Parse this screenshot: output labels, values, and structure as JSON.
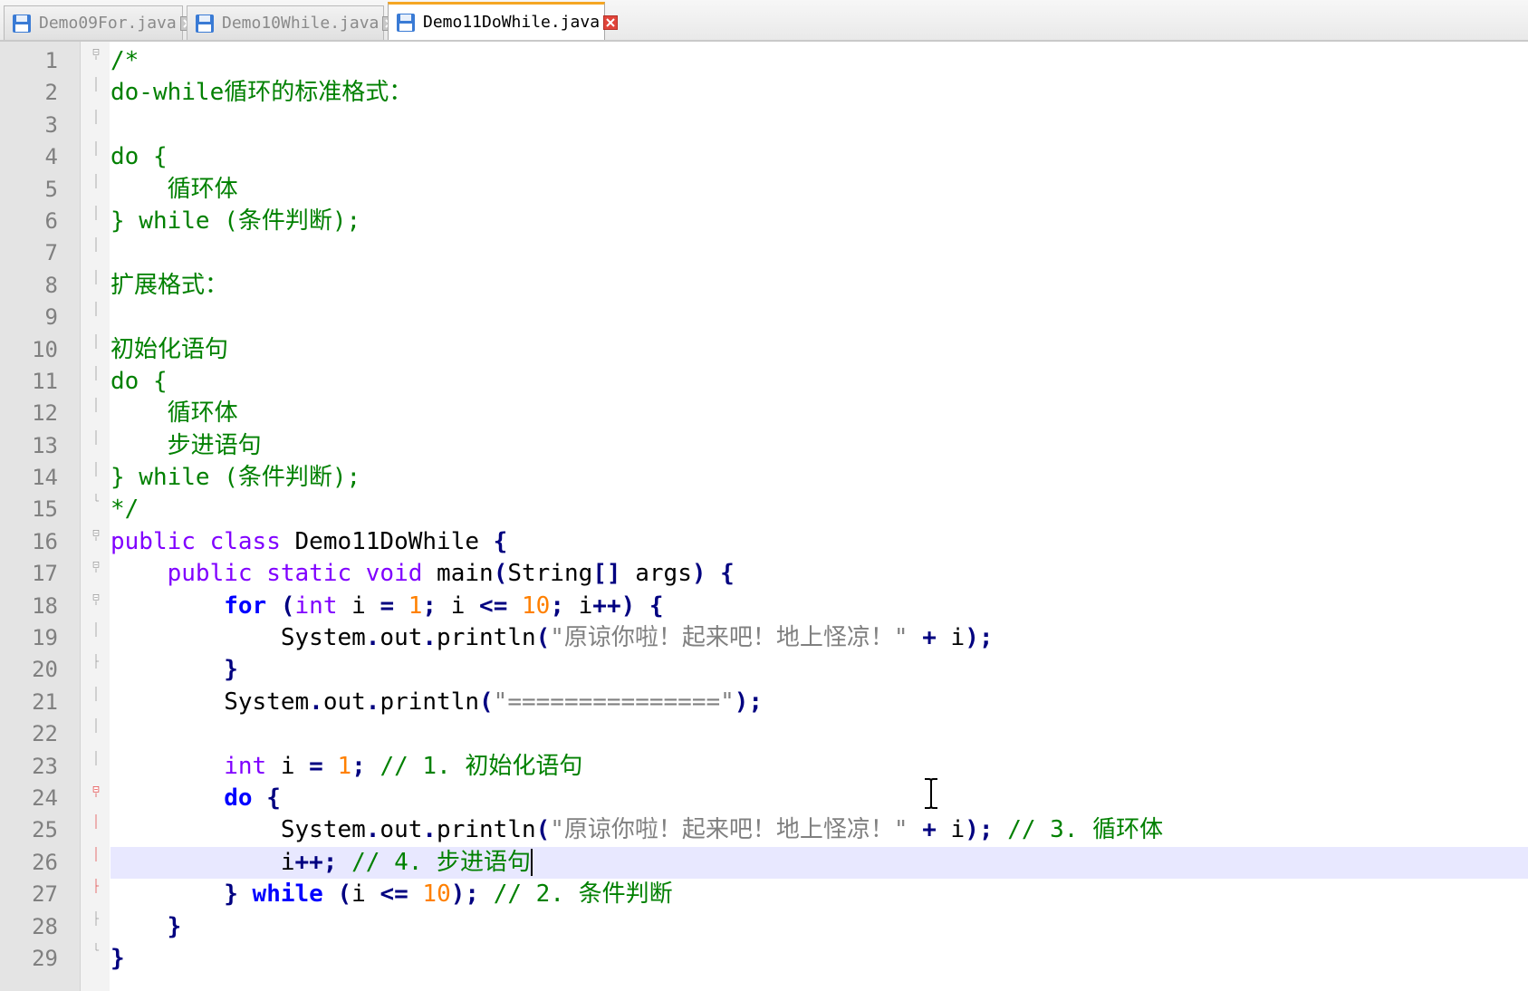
{
  "tabs": [
    {
      "label": "Demo09For.java",
      "active": false
    },
    {
      "label": "Demo10While.java",
      "active": false
    },
    {
      "label": "Demo11DoWhile.java",
      "active": true
    }
  ],
  "colors": {
    "comment": "#008000",
    "keyword": "#8000ff",
    "keyword_bold": "#0000ff",
    "number": "#ff8000",
    "string": "#808080",
    "operator": "#000080",
    "current_line": "#e8e8ff",
    "active_tab_accent": "#f5a623"
  },
  "editor": {
    "current_line": 26,
    "lines": [
      {
        "num": "1",
        "fold": "box-open",
        "tokens": [
          {
            "t": "/*",
            "c": "comment"
          }
        ]
      },
      {
        "num": "2",
        "fold": "line",
        "tokens": [
          {
            "t": "do-while循环的标准格式：",
            "c": "comment"
          }
        ]
      },
      {
        "num": "3",
        "fold": "line",
        "tokens": []
      },
      {
        "num": "4",
        "fold": "line",
        "tokens": [
          {
            "t": "do {",
            "c": "comment"
          }
        ]
      },
      {
        "num": "5",
        "fold": "line",
        "tokens": [
          {
            "t": "    循环体",
            "c": "comment"
          }
        ]
      },
      {
        "num": "6",
        "fold": "line",
        "tokens": [
          {
            "t": "} while (条件判断);",
            "c": "comment"
          }
        ]
      },
      {
        "num": "7",
        "fold": "line",
        "tokens": []
      },
      {
        "num": "8",
        "fold": "line",
        "tokens": [
          {
            "t": "扩展格式：",
            "c": "comment"
          }
        ]
      },
      {
        "num": "9",
        "fold": "line",
        "tokens": []
      },
      {
        "num": "10",
        "fold": "line",
        "tokens": [
          {
            "t": "初始化语句",
            "c": "comment"
          }
        ]
      },
      {
        "num": "11",
        "fold": "line",
        "tokens": [
          {
            "t": "do {",
            "c": "comment"
          }
        ]
      },
      {
        "num": "12",
        "fold": "line",
        "tokens": [
          {
            "t": "    循环体",
            "c": "comment"
          }
        ]
      },
      {
        "num": "13",
        "fold": "line",
        "tokens": [
          {
            "t": "    步进语句",
            "c": "comment"
          }
        ]
      },
      {
        "num": "14",
        "fold": "line",
        "tokens": [
          {
            "t": "} while (条件判断);",
            "c": "comment"
          }
        ]
      },
      {
        "num": "15",
        "fold": "end",
        "tokens": [
          {
            "t": "*/",
            "c": "comment"
          }
        ]
      },
      {
        "num": "16",
        "fold": "box-open",
        "tokens": [
          {
            "t": "public",
            "c": "kw"
          },
          {
            "t": " ",
            "c": "plain"
          },
          {
            "t": "class",
            "c": "kw"
          },
          {
            "t": " Demo11DoWhile ",
            "c": "plain"
          },
          {
            "t": "{",
            "c": "op"
          }
        ]
      },
      {
        "num": "17",
        "fold": "box-open",
        "tokens": [
          {
            "t": "    ",
            "c": "plain"
          },
          {
            "t": "public",
            "c": "kw"
          },
          {
            "t": " ",
            "c": "plain"
          },
          {
            "t": "static",
            "c": "kw"
          },
          {
            "t": " ",
            "c": "plain"
          },
          {
            "t": "void",
            "c": "kw"
          },
          {
            "t": " main",
            "c": "plain"
          },
          {
            "t": "(",
            "c": "op"
          },
          {
            "t": "String",
            "c": "plain"
          },
          {
            "t": "[]",
            "c": "op"
          },
          {
            "t": " args",
            "c": "plain"
          },
          {
            "t": ")",
            "c": "op"
          },
          {
            "t": " ",
            "c": "plain"
          },
          {
            "t": "{",
            "c": "op"
          }
        ]
      },
      {
        "num": "18",
        "fold": "box-open",
        "tokens": [
          {
            "t": "        ",
            "c": "plain"
          },
          {
            "t": "for",
            "c": "kwb"
          },
          {
            "t": " ",
            "c": "plain"
          },
          {
            "t": "(",
            "c": "op"
          },
          {
            "t": "int",
            "c": "kw"
          },
          {
            "t": " i ",
            "c": "plain"
          },
          {
            "t": "=",
            "c": "op"
          },
          {
            "t": " ",
            "c": "plain"
          },
          {
            "t": "1",
            "c": "num"
          },
          {
            "t": ";",
            "c": "op"
          },
          {
            "t": " i ",
            "c": "plain"
          },
          {
            "t": "<=",
            "c": "op"
          },
          {
            "t": " ",
            "c": "plain"
          },
          {
            "t": "10",
            "c": "num"
          },
          {
            "t": ";",
            "c": "op"
          },
          {
            "t": " i",
            "c": "plain"
          },
          {
            "t": "++)",
            "c": "op"
          },
          {
            "t": " ",
            "c": "plain"
          },
          {
            "t": "{",
            "c": "op"
          }
        ]
      },
      {
        "num": "19",
        "fold": "line",
        "tokens": [
          {
            "t": "            System",
            "c": "plain"
          },
          {
            "t": ".",
            "c": "op"
          },
          {
            "t": "out",
            "c": "plain"
          },
          {
            "t": ".",
            "c": "op"
          },
          {
            "t": "println",
            "c": "plain"
          },
          {
            "t": "(",
            "c": "op"
          },
          {
            "t": "\"原谅你啦！起来吧！地上怪凉！\"",
            "c": "str"
          },
          {
            "t": " ",
            "c": "plain"
          },
          {
            "t": "+",
            "c": "op"
          },
          {
            "t": " i",
            "c": "plain"
          },
          {
            "t": ");",
            "c": "op"
          }
        ]
      },
      {
        "num": "20",
        "fold": "tick",
        "tokens": [
          {
            "t": "        ",
            "c": "plain"
          },
          {
            "t": "}",
            "c": "op"
          }
        ]
      },
      {
        "num": "21",
        "fold": "line",
        "tokens": [
          {
            "t": "        System",
            "c": "plain"
          },
          {
            "t": ".",
            "c": "op"
          },
          {
            "t": "out",
            "c": "plain"
          },
          {
            "t": ".",
            "c": "op"
          },
          {
            "t": "println",
            "c": "plain"
          },
          {
            "t": "(",
            "c": "op"
          },
          {
            "t": "\"===============\"",
            "c": "str"
          },
          {
            "t": ");",
            "c": "op"
          }
        ]
      },
      {
        "num": "22",
        "fold": "line",
        "tokens": []
      },
      {
        "num": "23",
        "fold": "line",
        "tokens": [
          {
            "t": "        ",
            "c": "plain"
          },
          {
            "t": "int",
            "c": "kw"
          },
          {
            "t": " i ",
            "c": "plain"
          },
          {
            "t": "=",
            "c": "op"
          },
          {
            "t": " ",
            "c": "plain"
          },
          {
            "t": "1",
            "c": "num"
          },
          {
            "t": ";",
            "c": "op"
          },
          {
            "t": " ",
            "c": "plain"
          },
          {
            "t": "// 1. 初始化语句",
            "c": "comment"
          }
        ]
      },
      {
        "num": "24",
        "fold": "box-open-red",
        "tokens": [
          {
            "t": "        ",
            "c": "plain"
          },
          {
            "t": "do",
            "c": "kwb"
          },
          {
            "t": " ",
            "c": "plain"
          },
          {
            "t": "{",
            "c": "op"
          }
        ]
      },
      {
        "num": "25",
        "fold": "line-red",
        "tokens": [
          {
            "t": "            System",
            "c": "plain"
          },
          {
            "t": ".",
            "c": "op"
          },
          {
            "t": "out",
            "c": "plain"
          },
          {
            "t": ".",
            "c": "op"
          },
          {
            "t": "println",
            "c": "plain"
          },
          {
            "t": "(",
            "c": "op"
          },
          {
            "t": "\"原谅你啦！起来吧！地上怪凉！\"",
            "c": "str"
          },
          {
            "t": " ",
            "c": "plain"
          },
          {
            "t": "+",
            "c": "op"
          },
          {
            "t": " i",
            "c": "plain"
          },
          {
            "t": ");",
            "c": "op"
          },
          {
            "t": " ",
            "c": "plain"
          },
          {
            "t": "// 3. 循环体",
            "c": "comment"
          }
        ]
      },
      {
        "num": "26",
        "fold": "line-red",
        "caret": true,
        "tokens": [
          {
            "t": "            i",
            "c": "plain"
          },
          {
            "t": "++;",
            "c": "op"
          },
          {
            "t": " ",
            "c": "plain"
          },
          {
            "t": "// 4. 步进语句",
            "c": "comment"
          }
        ]
      },
      {
        "num": "27",
        "fold": "tick-red",
        "tokens": [
          {
            "t": "        ",
            "c": "plain"
          },
          {
            "t": "}",
            "c": "op"
          },
          {
            "t": " ",
            "c": "plain"
          },
          {
            "t": "while",
            "c": "kwb"
          },
          {
            "t": " ",
            "c": "plain"
          },
          {
            "t": "(",
            "c": "op"
          },
          {
            "t": "i ",
            "c": "plain"
          },
          {
            "t": "<=",
            "c": "op"
          },
          {
            "t": " ",
            "c": "plain"
          },
          {
            "t": "10",
            "c": "num"
          },
          {
            "t": ");",
            "c": "op"
          },
          {
            "t": " ",
            "c": "plain"
          },
          {
            "t": "// 2. 条件判断",
            "c": "comment"
          }
        ]
      },
      {
        "num": "28",
        "fold": "tick",
        "tokens": [
          {
            "t": "    ",
            "c": "plain"
          },
          {
            "t": "}",
            "c": "op"
          }
        ]
      },
      {
        "num": "29",
        "fold": "end",
        "tokens": [
          {
            "t": "}",
            "c": "op"
          }
        ]
      }
    ]
  }
}
